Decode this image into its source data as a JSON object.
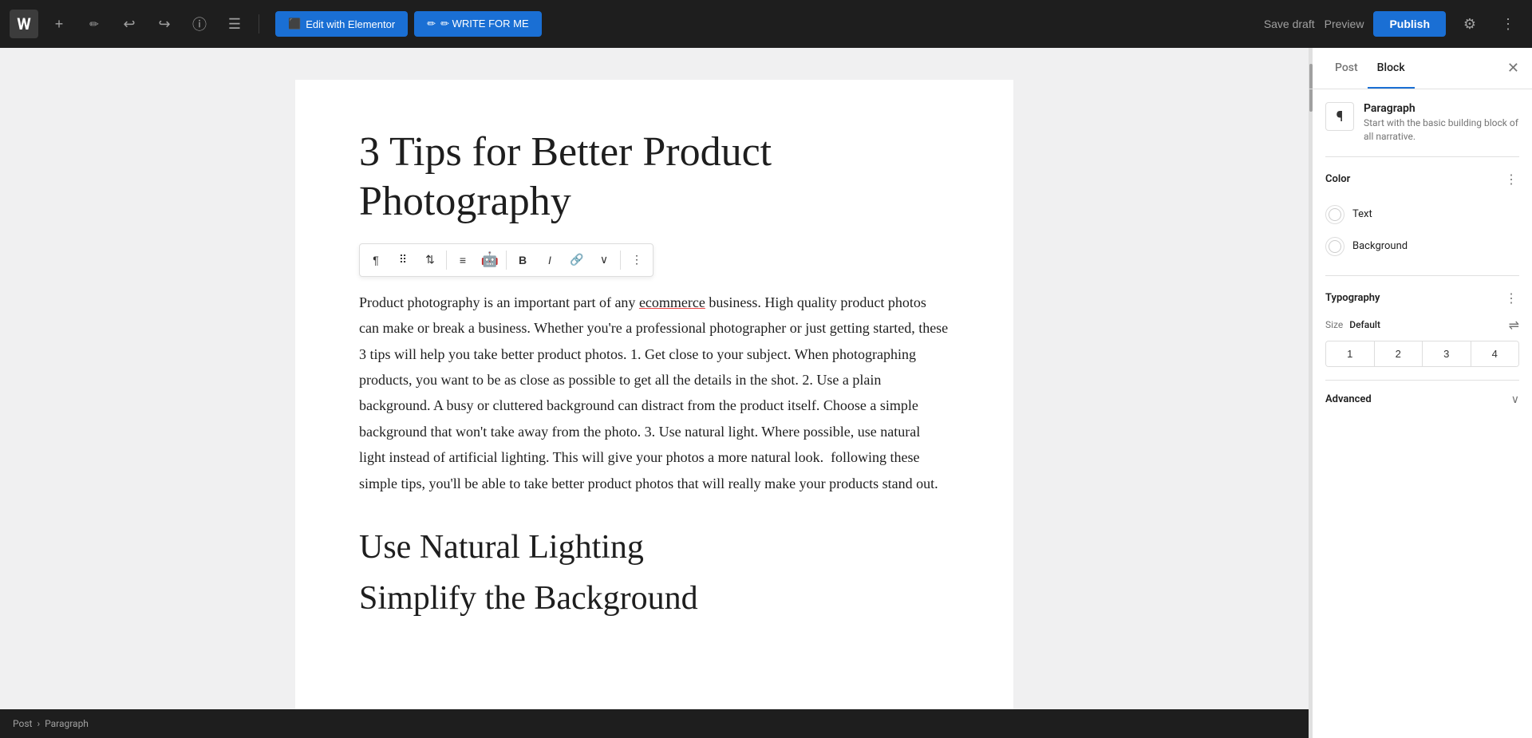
{
  "toolbar": {
    "add_label": "+",
    "undo_label": "↩",
    "redo_label": "↪",
    "info_label": "ⓘ",
    "list_label": "☰",
    "elementor_label": "Edit with Elementor",
    "write_for_me_label": "✏ WRITE FOR ME",
    "save_draft_label": "Save draft",
    "preview_label": "Preview",
    "publish_label": "Publish",
    "settings_label": "⚙",
    "more_label": "⋮"
  },
  "block_toolbar": {
    "paragraph_icon": "¶",
    "drag_icon": "⠿",
    "arrows_icon": "⇅",
    "align_icon": "≡",
    "emoji_icon": "🤖",
    "bold_label": "B",
    "italic_label": "I",
    "link_icon": "🔗",
    "chevron_icon": "∨",
    "more_icon": "⋮"
  },
  "editor": {
    "post_title": "3 Tips for Better Product Photography",
    "post_title_line1": "3 Tips for Better Product",
    "post_title_line2": "Photography",
    "body_text": "Product photography is an important part of any ecommerce business. High quality product photos can make or break a business. Whether you're a professional photographer or just getting started, these 3 tips will help you take better product photos. 1. Get close to your subject. When photographing products, you want to be as close as possible to get all the details in the shot. 2. Use a plain background. A busy or cluttered background can distract from the product itself. Choose a simple background that won't take away from the photo. 3. Use natural light. Where possible, use natural light instead of artificial lighting. This will give your photos a more natural look.  following these simple tips, you'll be able to take better product photos that will really make your products stand out.",
    "section_heading": "Use Natural Lighting",
    "partial_heading": "Simplify the Background"
  },
  "sidebar": {
    "tab_post_label": "Post",
    "tab_block_label": "Block",
    "close_label": "✕",
    "block_icon": "¶",
    "block_name": "Paragraph",
    "block_description": "Start with the basic building block of all narrative.",
    "color_section_label": "Color",
    "color_more_icon": "⋮",
    "color_text_label": "Text",
    "color_background_label": "Background",
    "typography_section_label": "Typography",
    "typography_more_icon": "⋮",
    "size_label": "Size",
    "size_value": "Default",
    "size_controls_icon": "⇌",
    "heading_levels": [
      "1",
      "2",
      "3",
      "4"
    ],
    "advanced_section_label": "Advanced",
    "advanced_chevron": "∨"
  },
  "breadcrumb": {
    "post_label": "Post",
    "separator": "›",
    "current_label": "Paragraph"
  }
}
